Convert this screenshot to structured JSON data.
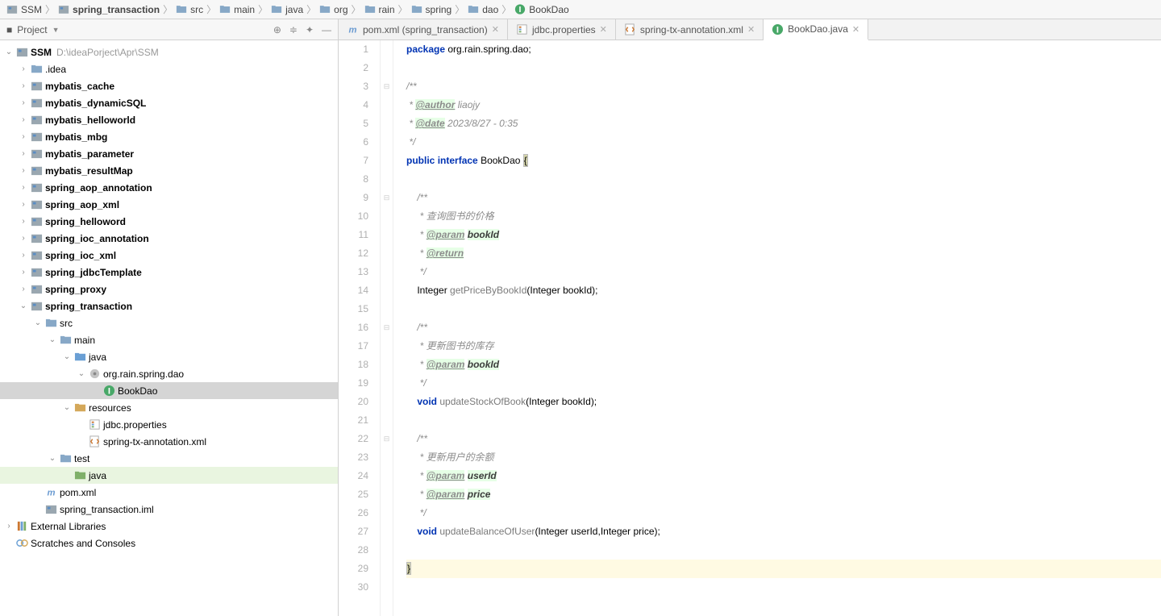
{
  "breadcrumb": [
    {
      "label": "SSM",
      "icon": "module"
    },
    {
      "label": "spring_transaction",
      "icon": "module-bold",
      "bold": true
    },
    {
      "label": "src",
      "icon": "folder"
    },
    {
      "label": "main",
      "icon": "folder"
    },
    {
      "label": "java",
      "icon": "folder"
    },
    {
      "label": "org",
      "icon": "folder"
    },
    {
      "label": "rain",
      "icon": "folder"
    },
    {
      "label": "spring",
      "icon": "folder"
    },
    {
      "label": "dao",
      "icon": "folder"
    },
    {
      "label": "BookDao",
      "icon": "interface"
    }
  ],
  "sidebar": {
    "title": "Project",
    "root": {
      "label": "SSM",
      "path": "D:\\ideaPorject\\Apr\\SSM",
      "icon": "module",
      "bold": true,
      "expanded": true
    },
    "nodes": [
      {
        "indent": 1,
        "arrow": ">",
        "icon": "folder",
        "label": ".idea"
      },
      {
        "indent": 1,
        "arrow": ">",
        "icon": "module",
        "label": "mybatis_cache",
        "bold": true
      },
      {
        "indent": 1,
        "arrow": ">",
        "icon": "module",
        "label": "mybatis_dynamicSQL",
        "bold": true
      },
      {
        "indent": 1,
        "arrow": ">",
        "icon": "module",
        "label": "mybatis_helloworld",
        "bold": true
      },
      {
        "indent": 1,
        "arrow": ">",
        "icon": "module",
        "label": "mybatis_mbg",
        "bold": true
      },
      {
        "indent": 1,
        "arrow": ">",
        "icon": "module",
        "label": "mybatis_parameter",
        "bold": true
      },
      {
        "indent": 1,
        "arrow": ">",
        "icon": "module",
        "label": "mybatis_resultMap",
        "bold": true
      },
      {
        "indent": 1,
        "arrow": ">",
        "icon": "module",
        "label": "spring_aop_annotation",
        "bold": true
      },
      {
        "indent": 1,
        "arrow": ">",
        "icon": "module",
        "label": "spring_aop_xml",
        "bold": true
      },
      {
        "indent": 1,
        "arrow": ">",
        "icon": "module",
        "label": "spring_helloword",
        "bold": true
      },
      {
        "indent": 1,
        "arrow": ">",
        "icon": "module",
        "label": "spring_ioc_annotation",
        "bold": true
      },
      {
        "indent": 1,
        "arrow": ">",
        "icon": "module",
        "label": "spring_ioc_xml",
        "bold": true
      },
      {
        "indent": 1,
        "arrow": ">",
        "icon": "module",
        "label": "spring_jdbcTemplate",
        "bold": true
      },
      {
        "indent": 1,
        "arrow": ">",
        "icon": "module",
        "label": "spring_proxy",
        "bold": true
      },
      {
        "indent": 1,
        "arrow": "v",
        "icon": "module",
        "label": "spring_transaction",
        "bold": true
      },
      {
        "indent": 2,
        "arrow": "v",
        "icon": "folder",
        "label": "src"
      },
      {
        "indent": 3,
        "arrow": "v",
        "icon": "folder",
        "label": "main"
      },
      {
        "indent": 4,
        "arrow": "v",
        "icon": "folder-src",
        "label": "java"
      },
      {
        "indent": 5,
        "arrow": "v",
        "icon": "package",
        "label": "org.rain.spring.dao"
      },
      {
        "indent": 6,
        "arrow": " ",
        "icon": "interface",
        "label": "BookDao",
        "sel": true
      },
      {
        "indent": 4,
        "arrow": "v",
        "icon": "folder-res",
        "label": "resources"
      },
      {
        "indent": 5,
        "arrow": " ",
        "icon": "props",
        "label": "jdbc.properties"
      },
      {
        "indent": 5,
        "arrow": " ",
        "icon": "xml",
        "label": "spring-tx-annotation.xml"
      },
      {
        "indent": 3,
        "arrow": "v",
        "icon": "folder",
        "label": "test"
      },
      {
        "indent": 4,
        "arrow": " ",
        "icon": "folder-test",
        "label": "java",
        "hl": true
      },
      {
        "indent": 2,
        "arrow": " ",
        "icon": "m",
        "label": "pom.xml"
      },
      {
        "indent": 2,
        "arrow": " ",
        "icon": "module",
        "label": "spring_transaction.iml"
      },
      {
        "indent": 0,
        "arrow": ">",
        "icon": "lib",
        "label": "External Libraries"
      },
      {
        "indent": 0,
        "arrow": " ",
        "icon": "scratch",
        "label": "Scratches and Consoles"
      }
    ]
  },
  "tabs": [
    {
      "icon": "m",
      "label": "pom.xml (spring_transaction)",
      "active": false
    },
    {
      "icon": "props",
      "label": "jdbc.properties",
      "active": false
    },
    {
      "icon": "xml",
      "label": "spring-tx-annotation.xml",
      "active": false
    },
    {
      "icon": "interface",
      "label": "BookDao.java",
      "active": true
    }
  ],
  "code": {
    "lines": [
      {
        "n": 1,
        "html": "<span class='kw'>package</span> org.rain.spring.dao;"
      },
      {
        "n": 2,
        "html": ""
      },
      {
        "n": 3,
        "html": "<span class='comment'>/**</span>",
        "fold": "-"
      },
      {
        "n": 4,
        "html": "<span class='comment'> * <span class='tag'>@author</span> liaojy</span>"
      },
      {
        "n": 5,
        "html": "<span class='comment'> * <span class='tag'>@date</span> 2023/8/27 - 0:35</span>"
      },
      {
        "n": 6,
        "html": "<span class='comment'> */</span>"
      },
      {
        "n": 7,
        "html": "<span class='kw'>public</span> <span class='kw'>interface</span> <span class='cls'>BookDao</span> <span class='brace-match'>{</span>"
      },
      {
        "n": 8,
        "html": ""
      },
      {
        "n": 9,
        "html": "    <span class='comment'>/**</span>",
        "fold": "-"
      },
      {
        "n": 10,
        "html": "    <span class='comment'> * 查询图书的价格</span>"
      },
      {
        "n": 11,
        "html": "    <span class='comment'> * <span class='tag'>@param</span> <span class='tagparam'>bookId</span></span>"
      },
      {
        "n": 12,
        "html": "    <span class='comment'> * <span class='tag'>@return</span></span>"
      },
      {
        "n": 13,
        "html": "    <span class='comment'> */</span>"
      },
      {
        "n": 14,
        "html": "    Integer <span class='meth'>getPriceByBookId</span>(Integer bookId);"
      },
      {
        "n": 15,
        "html": ""
      },
      {
        "n": 16,
        "html": "    <span class='comment'>/**</span>",
        "fold": "-"
      },
      {
        "n": 17,
        "html": "    <span class='comment'> * 更新图书的库存</span>"
      },
      {
        "n": 18,
        "html": "    <span class='comment'> * <span class='tag'>@param</span> <span class='tagparam'>bookId</span></span>"
      },
      {
        "n": 19,
        "html": "    <span class='comment'> */</span>"
      },
      {
        "n": 20,
        "html": "    <span class='kw'>void</span> <span class='meth'>updateStockOfBook</span>(Integer bookId);"
      },
      {
        "n": 21,
        "html": ""
      },
      {
        "n": 22,
        "html": "    <span class='comment'>/**</span>",
        "fold": "-"
      },
      {
        "n": 23,
        "html": "    <span class='comment'> * 更新用户的余额</span>"
      },
      {
        "n": 24,
        "html": "    <span class='comment'> * <span class='tag'>@param</span> <span class='tagparam'>userId</span></span>"
      },
      {
        "n": 25,
        "html": "    <span class='comment'> * <span class='tag'>@param</span> <span class='tagparam'>price</span></span>"
      },
      {
        "n": 26,
        "html": "    <span class='comment'> */</span>"
      },
      {
        "n": 27,
        "html": "    <span class='kw'>void</span> <span class='meth'>updateBalanceOfUser</span>(Integer userId,Integer price);"
      },
      {
        "n": 28,
        "html": ""
      },
      {
        "n": 29,
        "html": "<span class='brace-match'>}</span>",
        "cursor": true
      },
      {
        "n": 30,
        "html": ""
      }
    ]
  }
}
